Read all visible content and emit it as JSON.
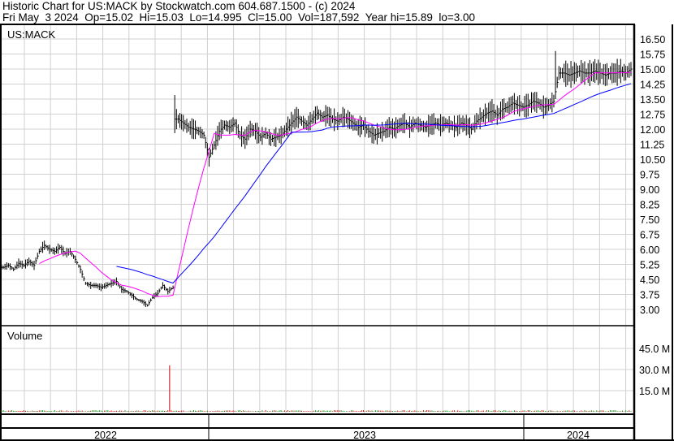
{
  "header": {
    "title": "Historic Chart for US:MACK by Stockwatch.com 604.687.1500 - (c) 2024",
    "quote": "Fri May  3 2024  Op=15.02  Hi=15.03  Lo=14.995  Cl=15.00  Vol=187,592  Year hi=15.89  lo=3.00"
  },
  "chart_data": {
    "type": "line",
    "title": "US:MACK",
    "price_axis": {
      "ticks": [
        "16.50",
        "15.75",
        "15.00",
        "14.25",
        "13.50",
        "12.75",
        "12.00",
        "11.25",
        "10.50",
        "9.75",
        "9.00",
        "8.25",
        "7.50",
        "6.75",
        "6.00",
        "5.25",
        "4.50",
        "3.75",
        "3.00"
      ],
      "ylim": [
        3.0,
        16.5
      ]
    },
    "volume_panel": {
      "label": "Volume",
      "ticks": [
        "45.0 M",
        "30.0 M",
        "15.0 M"
      ],
      "ylim": [
        0,
        45
      ],
      "unit": "M",
      "spike_index": 33,
      "spike_value": 33
    },
    "x_labels": [
      "2022",
      "2023",
      "2024"
    ],
    "series": [
      {
        "name": "Close",
        "color": "#000000",
        "values": [
          5.1,
          5.2,
          5.0,
          5.3,
          5.2,
          5.4,
          5.2,
          5.9,
          6.2,
          6.0,
          5.9,
          6.1,
          5.8,
          5.9,
          5.5,
          5.0,
          4.3,
          4.2,
          4.2,
          4.1,
          4.2,
          4.3,
          4.4,
          4.0,
          3.9,
          3.7,
          3.5,
          3.4,
          3.2,
          3.6,
          3.8,
          4.2,
          3.9,
          4.1,
          12.5,
          12.3,
          12.1,
          12.0,
          11.9,
          11.7,
          10.6,
          11.2,
          11.9,
          12.2,
          12.1,
          12.3,
          11.7,
          11.5,
          12.0,
          11.9,
          11.6,
          11.8,
          11.5,
          11.6,
          11.7,
          12.0,
          12.3,
          12.6,
          12.4,
          12.2,
          12.5,
          12.8,
          12.6,
          12.7,
          12.5,
          12.4,
          12.6,
          12.5,
          12.3,
          12.1,
          12.2,
          11.9,
          11.7,
          11.8,
          11.9,
          12.1,
          12.0,
          12.2,
          12.3,
          12.1,
          12.3,
          12.2,
          12.1,
          12.2,
          12.3,
          12.2,
          12.3,
          12.2,
          12.1,
          12.3,
          12.2,
          12.0,
          12.4,
          12.6,
          12.8,
          12.9,
          12.7,
          13.0,
          13.1,
          13.3,
          13.2,
          13.1,
          13.2,
          13.4,
          13.3,
          13.1,
          13.2,
          13.4,
          14.8,
          14.8,
          14.7,
          14.8,
          14.9,
          14.8,
          14.8,
          14.9,
          14.8,
          14.7,
          14.8,
          14.8,
          14.9,
          14.8,
          15.0
        ]
      },
      {
        "name": "Short MA",
        "color": "#ff00ff",
        "window": 8
      },
      {
        "name": "Long MA",
        "color": "#0000ff",
        "window": 23
      }
    ]
  }
}
